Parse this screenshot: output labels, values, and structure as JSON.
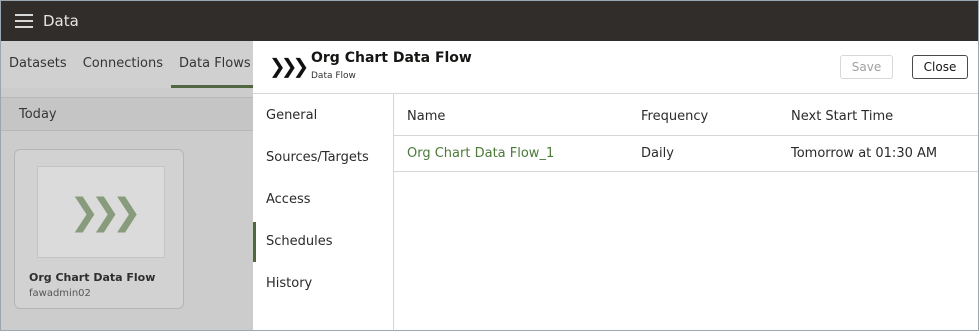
{
  "app": {
    "title": "Data"
  },
  "tabs": [
    {
      "label": "Datasets"
    },
    {
      "label": "Connections"
    },
    {
      "label": "Data Flows"
    }
  ],
  "list": {
    "group_label": "Today",
    "card": {
      "title": "Org Chart Data Flow",
      "owner": "fawadmin02",
      "icon": "data-flow-chevrons-icon"
    }
  },
  "dialog": {
    "icon": "data-flow-chevrons-icon",
    "title": "Org Chart Data Flow",
    "subtitle": "Data Flow",
    "save_label": "Save",
    "close_label": "Close",
    "nav": [
      {
        "label": "General"
      },
      {
        "label": "Sources/Targets"
      },
      {
        "label": "Access"
      },
      {
        "label": "Schedules"
      },
      {
        "label": "History"
      }
    ],
    "active_nav": "Schedules",
    "table": {
      "columns": [
        "Name",
        "Frequency",
        "Next Start Time"
      ],
      "rows": [
        [
          "Org Chart Data Flow_1",
          "Daily",
          "Tomorrow at 01:30 AM"
        ]
      ]
    }
  },
  "colors": {
    "accent": "#4d6b3a",
    "topbar": "#312d2a",
    "link": "#4d7a3a"
  }
}
